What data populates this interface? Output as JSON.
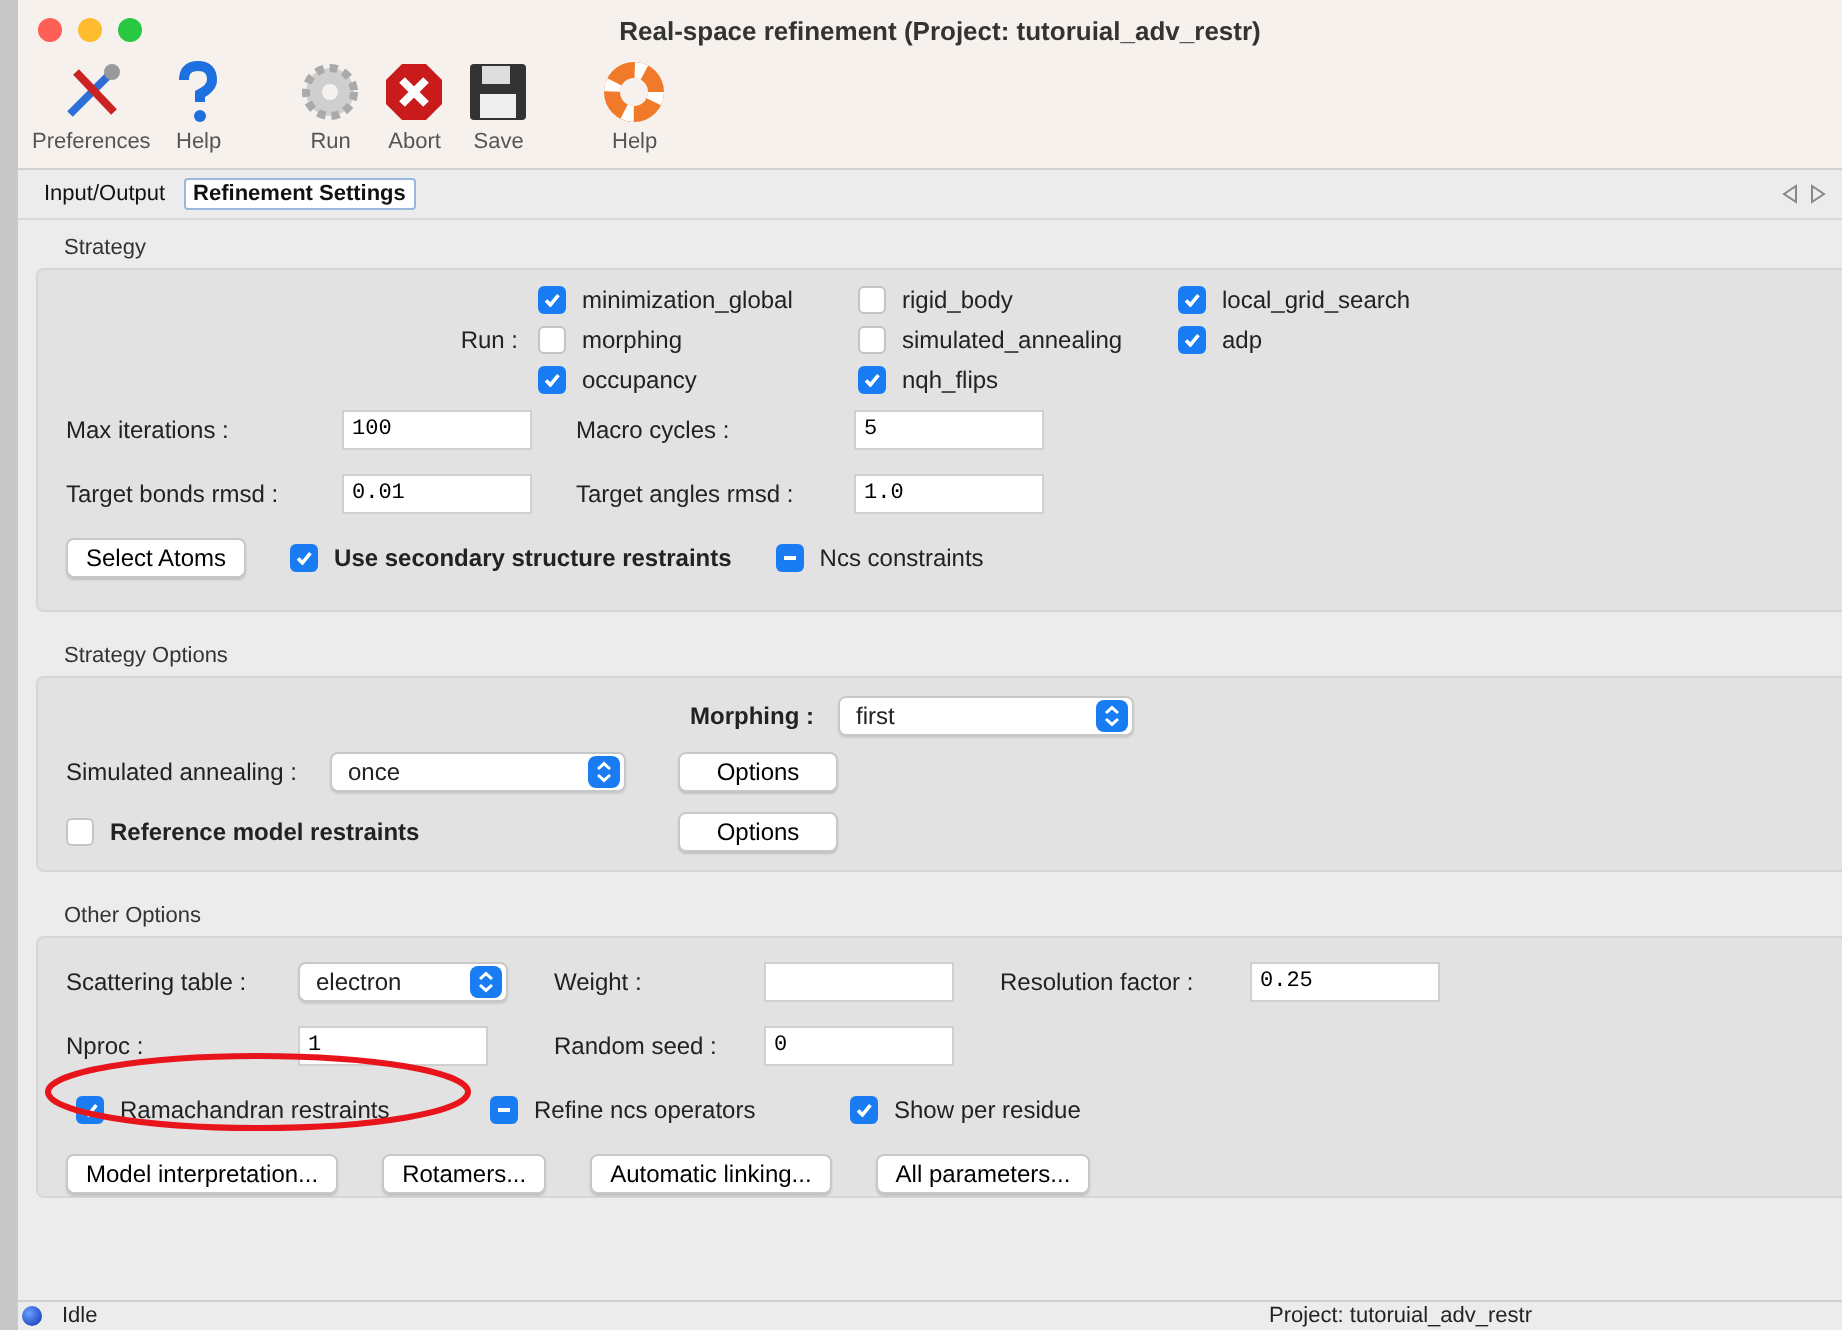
{
  "window": {
    "title": "Real-space refinement (Project: tutoruial_adv_restr)"
  },
  "toolbar": [
    [
      {
        "label": "Preferences",
        "kind": "preferences"
      },
      {
        "label": "Help",
        "kind": "help"
      }
    ],
    [
      {
        "label": "Run",
        "kind": "run"
      },
      {
        "label": "Abort",
        "kind": "abort"
      },
      {
        "label": "Save",
        "kind": "save"
      }
    ],
    [
      {
        "label": "Help",
        "kind": "lifebuoy"
      }
    ]
  ],
  "tabs": [
    {
      "label": "Input/Output",
      "selected": false
    },
    {
      "label": "Refinement Settings",
      "selected": true
    }
  ],
  "strategy": {
    "title": "Strategy",
    "run_label": "Run :",
    "run_options": [
      {
        "label": "minimization_global",
        "checked": true
      },
      {
        "label": "rigid_body",
        "checked": false
      },
      {
        "label": "local_grid_search",
        "checked": true
      },
      {
        "label": "morphing",
        "checked": false
      },
      {
        "label": "simulated_annealing",
        "checked": false
      },
      {
        "label": "adp",
        "checked": true
      },
      {
        "label": "occupancy",
        "checked": true
      },
      {
        "label": "nqh_flips",
        "checked": true
      }
    ],
    "fields": [
      {
        "label": "Max iterations :",
        "value": "100"
      },
      {
        "label": "Macro cycles :",
        "value": "5"
      },
      {
        "label": "Target bonds rmsd :",
        "value": "0.01"
      },
      {
        "label": "Target angles rmsd :",
        "value": "1.0"
      }
    ],
    "select_atoms": "Select Atoms",
    "options": [
      {
        "label": "Use secondary structure restraints",
        "checked": true
      },
      {
        "label": "Ncs constraints",
        "indeterminate": true
      }
    ]
  },
  "strategy_options": {
    "title": "Strategy Options",
    "morphing": {
      "label": "Morphing :",
      "value": "first"
    },
    "annealing": {
      "label": "Simulated annealing :",
      "value": "once"
    },
    "annealing_button": "Options",
    "reference": {
      "label": "Reference model restraints",
      "checked": false
    },
    "reference_button": "Options"
  },
  "other_options": {
    "title": "Other Options",
    "scattering": {
      "label": "Scattering table :",
      "value": "electron"
    },
    "weight": {
      "label": "Weight :"
    },
    "resolution": {
      "label": "Resolution factor :",
      "value": "0.25"
    },
    "nproc": {
      "label": "Nproc :",
      "value": "1"
    },
    "seed": {
      "label": "Random seed :",
      "value": "0"
    },
    "checks": [
      {
        "label": "Ramachandran restraints",
        "checked": true
      },
      {
        "label": "Refine ncs operators",
        "indeterminate": true
      },
      {
        "label": "Show per residue",
        "checked": true
      }
    ],
    "buttons": [
      "Model interpretation...",
      "Rotamers...",
      "Automatic linking...",
      "All parameters..."
    ]
  },
  "status_bar": {
    "status": "Idle",
    "project": "Project: tutoruial_adv_restr"
  }
}
